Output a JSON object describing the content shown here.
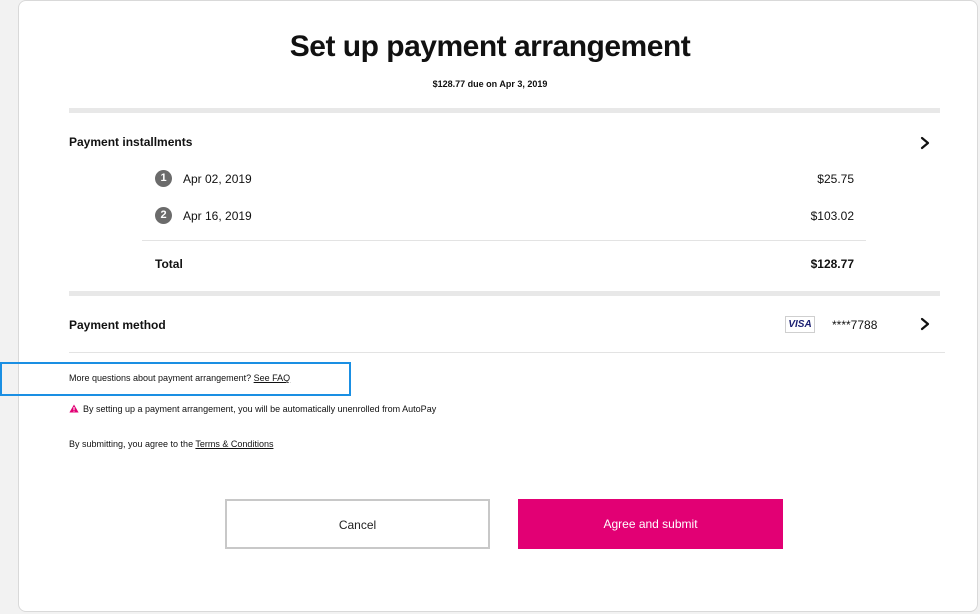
{
  "header": {
    "title": "Set up payment arrangement",
    "subtitle": "$128.77 due on Apr 3, 2019"
  },
  "installments": {
    "label": "Payment installments",
    "items": [
      {
        "num": "1",
        "date": "Apr 02, 2019",
        "amount": "$25.75"
      },
      {
        "num": "2",
        "date": "Apr 16, 2019",
        "amount": "$103.02"
      }
    ],
    "total_label": "Total",
    "total_amount": "$128.77"
  },
  "payment_method": {
    "label": "Payment method",
    "card_brand": "VISA",
    "card_number": "****7788"
  },
  "notes": {
    "faq_text": "More questions about payment arrangement?",
    "faq_link": "See FAQ",
    "warning": "By setting up a payment arrangement, you will be automatically unenrolled from AutoPay",
    "terms_text": "By submitting, you agree to the",
    "terms_link": "Terms & Conditions"
  },
  "actions": {
    "cancel_label": "Cancel",
    "submit_label": "Agree and submit"
  },
  "colors": {
    "accent": "#e20074",
    "highlight": "#1a8fe3",
    "warning": "#e20074"
  },
  "icons": {
    "chevron": "chevron-right-icon",
    "warning": "warning-triangle-icon",
    "card": "visa-card-icon"
  }
}
